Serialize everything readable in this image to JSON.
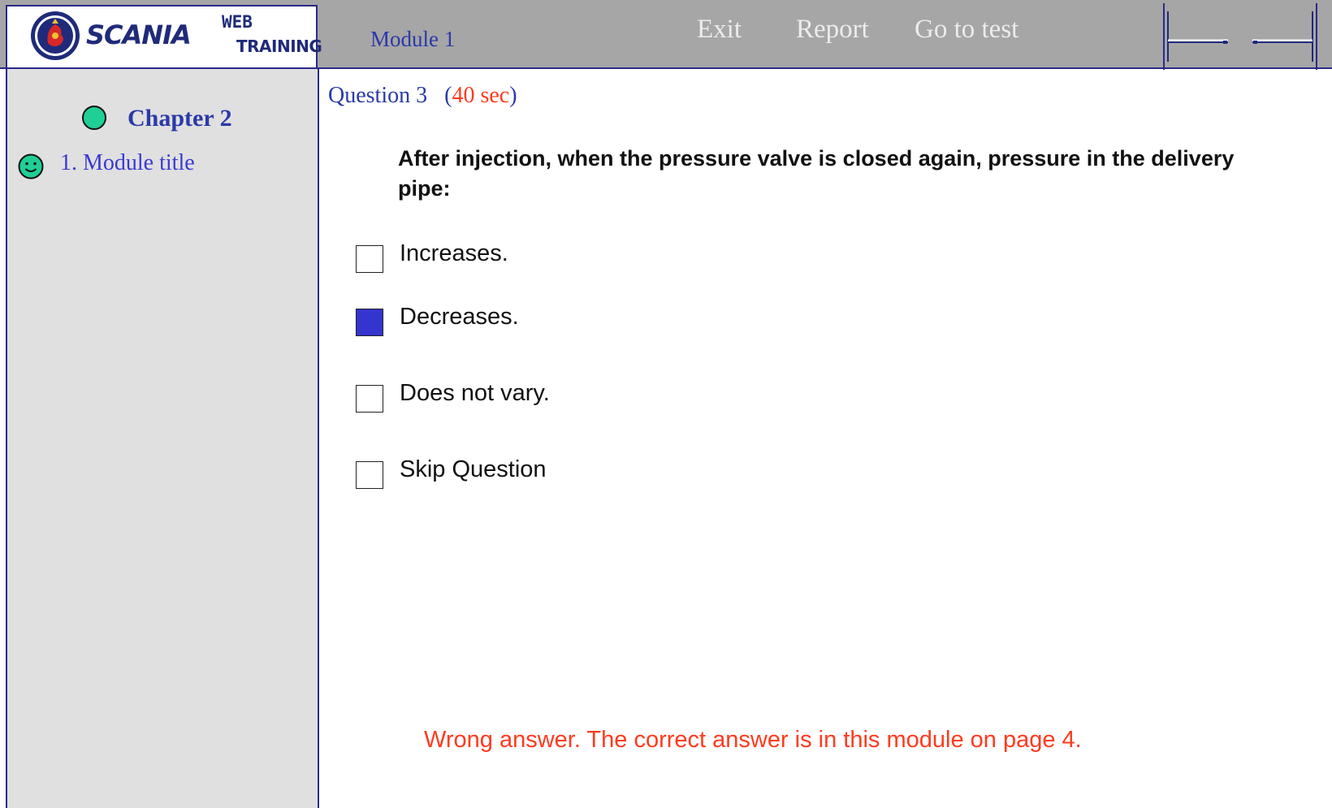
{
  "header": {
    "logo": {
      "wordmark": "SCANIA",
      "line1": "WEB",
      "line2": "TRAINING"
    },
    "module_title": "Module 1",
    "links": {
      "exit": "Exit",
      "report": "Report",
      "go_to_test": "Go to test"
    },
    "nav_icons": [
      "arrow-left-icon",
      "arrow-right-icon"
    ]
  },
  "sidebar": {
    "chapter_label": "Chapter 2",
    "chapter_status_color": "#1fcf96",
    "module_item_label": "1. Module title",
    "module_item_icon": "smiley-icon"
  },
  "main": {
    "question_label": "Question 3",
    "timer_open": "(",
    "timer_value": "40  sec",
    "timer_close": ")",
    "question_text": "After injection, when the pressure valve is closed again, pressure in the delivery pipe:",
    "options": [
      {
        "label": "Increases.",
        "checked": false
      },
      {
        "label": "Decreases.",
        "checked": true
      },
      {
        "label": "Does not vary.",
        "checked": false
      },
      {
        "label": "Skip Question",
        "checked": false
      }
    ],
    "feedback": "Wrong answer. The correct answer is in this module on page 4."
  },
  "colors": {
    "accent_blue": "#2a3aa8",
    "header_gray": "#a6a6a6",
    "sidebar_gray": "#e0e0e0",
    "checked_fill": "#3434cf",
    "error_red": "#ff3b1e"
  }
}
